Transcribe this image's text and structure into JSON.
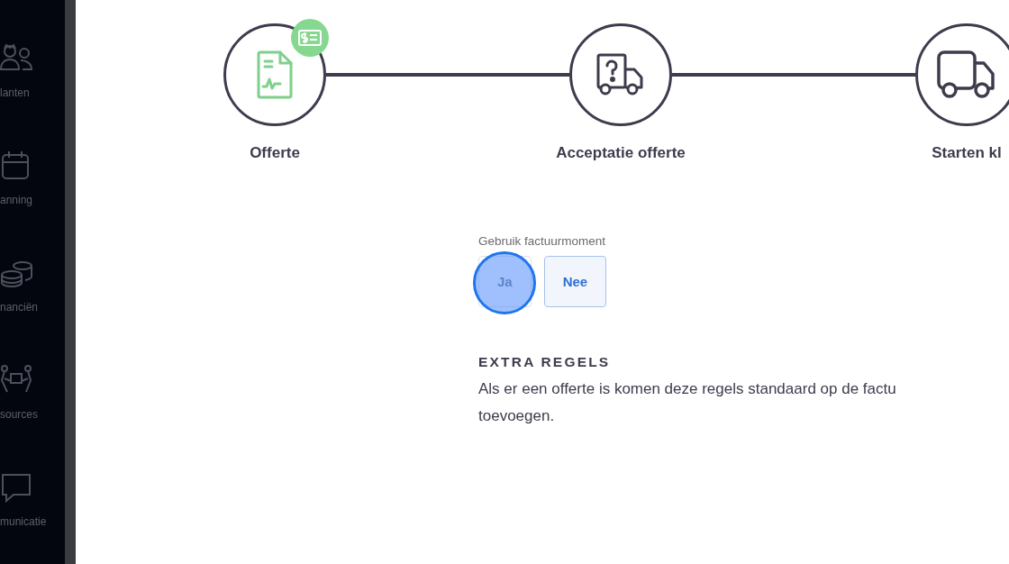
{
  "sidebar": {
    "items": [
      {
        "label": "lanten"
      },
      {
        "label": "anning"
      },
      {
        "label": "nanciën"
      },
      {
        "label": "sources"
      },
      {
        "label": "municatie"
      }
    ]
  },
  "steps": [
    {
      "label": "Offerte",
      "completed": true
    },
    {
      "label": "Acceptatie offerte",
      "completed": false
    },
    {
      "label": "Starten kl",
      "completed": false
    }
  ],
  "invoice_moment": {
    "label": "Gebruik factuurmoment",
    "options": [
      {
        "label": "Ja",
        "selected": false
      },
      {
        "label": "Nee",
        "selected": true
      }
    ]
  },
  "extra_rules": {
    "heading": "EXTRA REGELS",
    "lines": [
      "Als er een offerte is komen deze regels standaard op de factu",
      "toevoegen."
    ]
  }
}
